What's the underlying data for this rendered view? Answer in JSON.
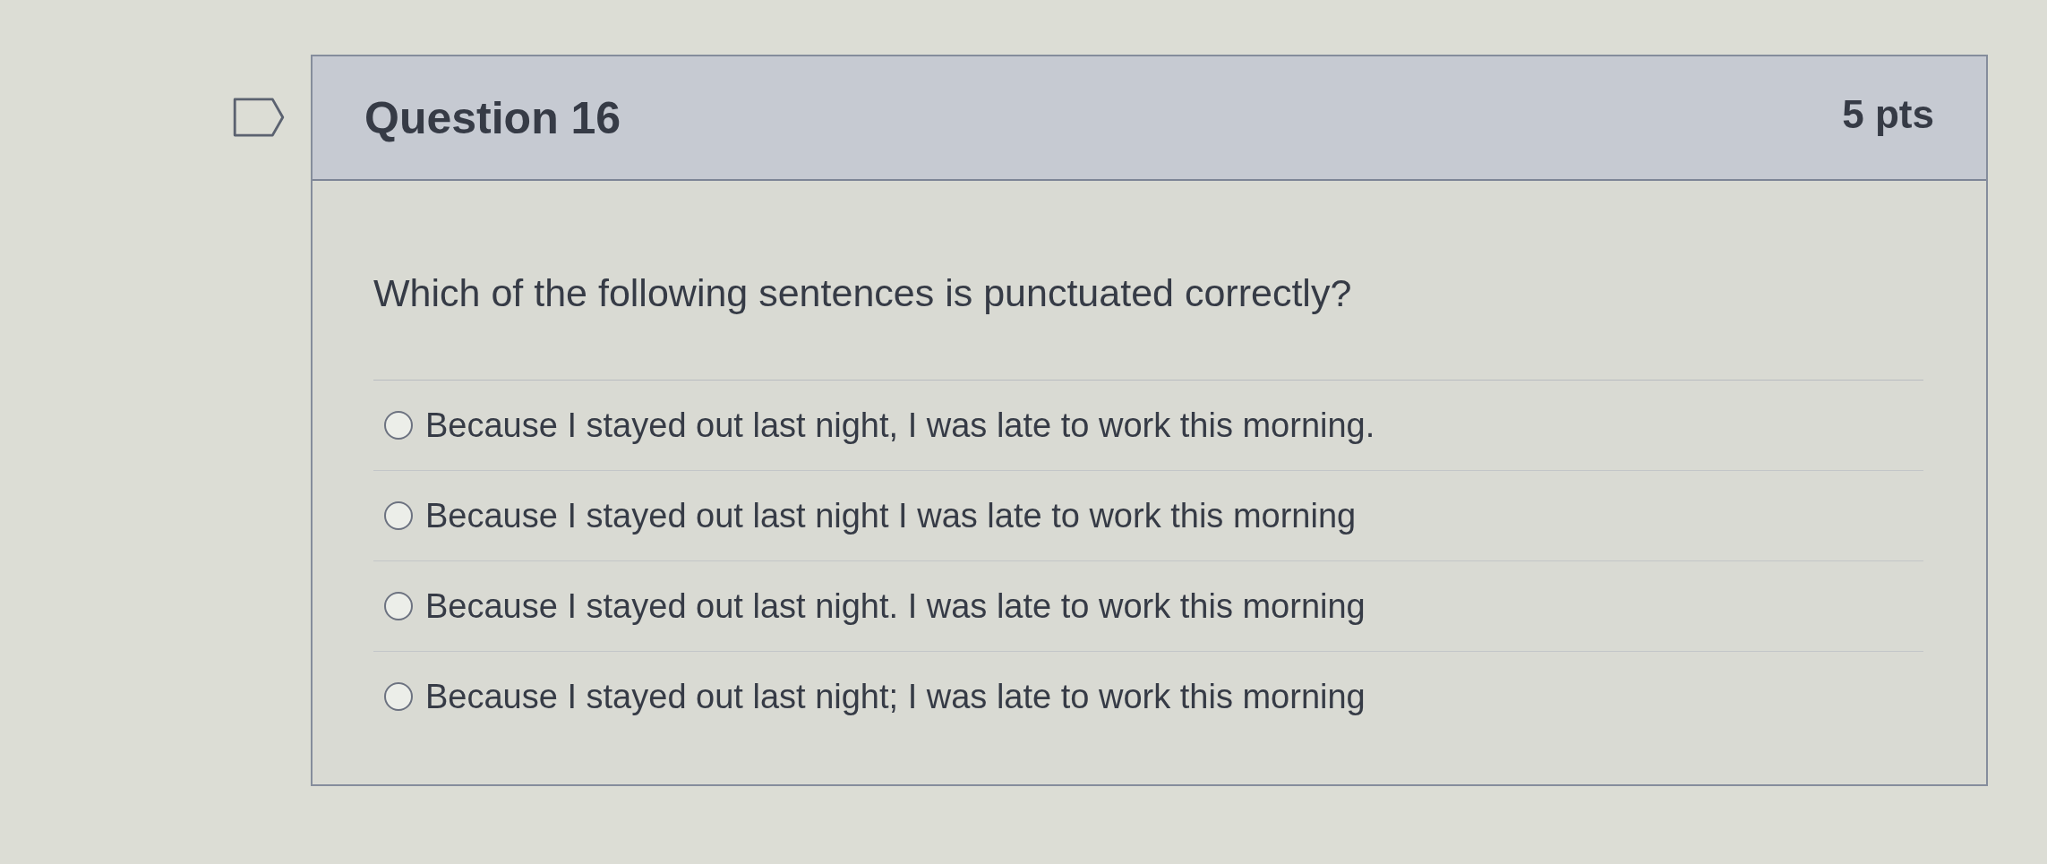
{
  "question": {
    "title": "Question 16",
    "points": "5 pts",
    "flagged": false,
    "prompt": "Which of the following sentences is punctuated correctly?",
    "answers": [
      {
        "text": "Because I stayed out last night, I was late to work this morning.",
        "selected": false
      },
      {
        "text": "Because I stayed out last night I was late to work this morning",
        "selected": false
      },
      {
        "text": "Because I stayed out last night. I was late to work this morning",
        "selected": false
      },
      {
        "text": "Because I stayed out last night; I was late to work this morning",
        "selected": false
      }
    ]
  }
}
